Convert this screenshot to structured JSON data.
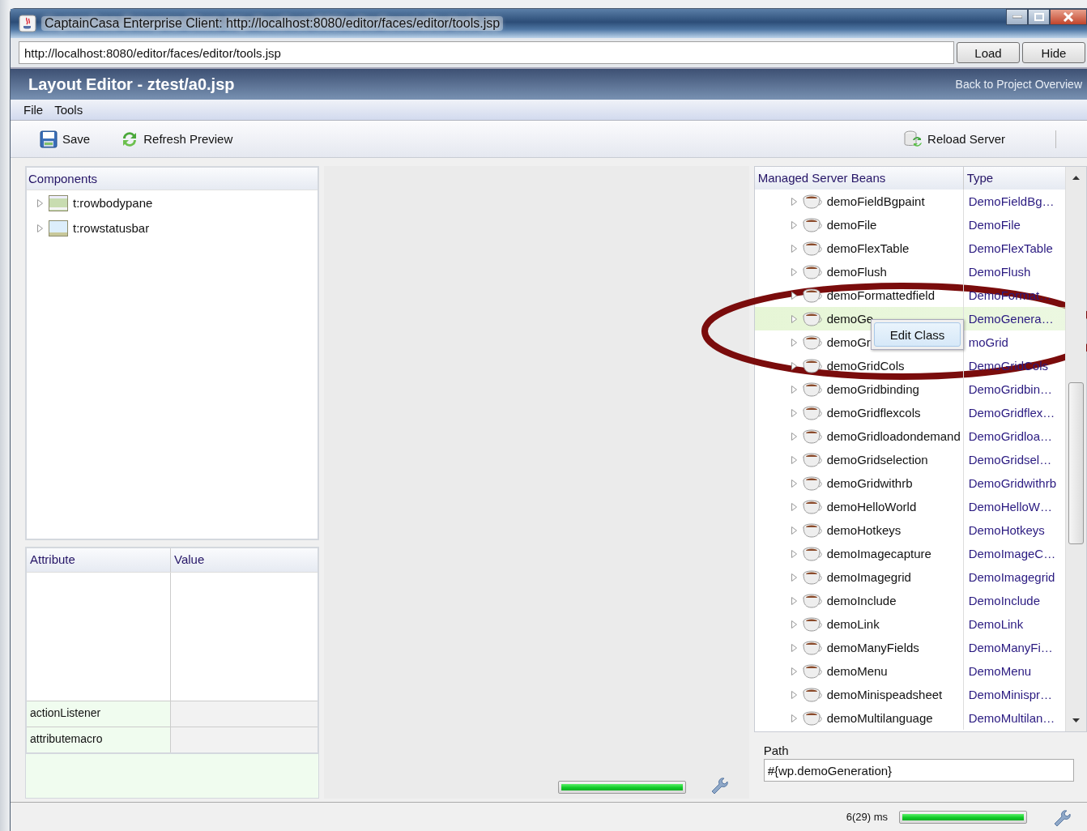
{
  "window": {
    "title": "CaptainCasa Enterprise Client: http://localhost:8080/editor/faces/editor/tools.jsp"
  },
  "address": {
    "value": "http://localhost:8080/editor/faces/editor/tools.jsp",
    "buttons": [
      "Load",
      "Hide"
    ]
  },
  "header": {
    "title": "Layout Editor - ztest/a0.jsp",
    "link": "Back to Project Overview"
  },
  "menu": [
    "File",
    "Tools"
  ],
  "toolbar": [
    {
      "label": "Save",
      "kind": "save"
    },
    {
      "label": "Refresh Preview",
      "kind": "refresh"
    },
    {
      "label": "Reload Server",
      "kind": "reload"
    }
  ],
  "components": {
    "title": "Components",
    "items": [
      {
        "label": "t:rowbodypane",
        "kind": "bodypane",
        "expanded": false
      },
      {
        "label": "t:rowstatusbar",
        "kind": "statusbar",
        "expanded": false
      }
    ]
  },
  "attributes": {
    "columns": [
      "Attribute",
      "Value"
    ],
    "rows": [
      {
        "attribute": "actionListener"
      },
      {
        "attribute": "attributemacro"
      }
    ]
  },
  "preview": {
    "level": 1
  },
  "beans": {
    "columns": [
      "Managed Server Beans",
      "Type"
    ],
    "rows": [
      {
        "name": "demoFieldBgpaint",
        "type": "DemoFieldBg…",
        "expanded": false,
        "selected": false
      },
      {
        "name": "demoFile",
        "type": "DemoFile",
        "expanded": false,
        "selected": false
      },
      {
        "name": "demoFlexTable",
        "type": "DemoFlexTable",
        "expanded": false,
        "selected": false
      },
      {
        "name": "demoFlush",
        "type": "DemoFlush",
        "expanded": false,
        "selected": false
      },
      {
        "name": "demoFormattedfield",
        "type": "DemoFormat…",
        "expanded": false,
        "selected": false
      },
      {
        "name": "demoGe",
        "type": "DemoGenera…",
        "expanded": false,
        "selected": true
      },
      {
        "name": "demoGr",
        "type": "moGrid",
        "expanded": false,
        "selected": false
      },
      {
        "name": "demoGridCols",
        "type": "DemoGridCols",
        "expanded": false,
        "selected": false
      },
      {
        "name": "demoGridbinding",
        "type": "DemoGridbin…",
        "expanded": false,
        "selected": false
      },
      {
        "name": "demoGridflexcols",
        "type": "DemoGridflex…",
        "expanded": false,
        "selected": false
      },
      {
        "name": "demoGridloadondemand",
        "type": "DemoGridloa…",
        "expanded": false,
        "selected": false
      },
      {
        "name": "demoGridselection",
        "type": "DemoGridsel…",
        "expanded": false,
        "selected": false
      },
      {
        "name": "demoGridwithrb",
        "type": "DemoGridwithrb",
        "expanded": false,
        "selected": false
      },
      {
        "name": "demoHelloWorld",
        "type": "DemoHelloW…",
        "expanded": false,
        "selected": false
      },
      {
        "name": "demoHotkeys",
        "type": "DemoHotkeys",
        "expanded": false,
        "selected": false
      },
      {
        "name": "demoImagecapture",
        "type": "DemoImageC…",
        "expanded": false,
        "selected": false
      },
      {
        "name": "demoImagegrid",
        "type": "DemoImagegrid",
        "expanded": false,
        "selected": false
      },
      {
        "name": "demoInclude",
        "type": "DemoInclude",
        "expanded": false,
        "selected": false
      },
      {
        "name": "demoLink",
        "type": "DemoLink",
        "expanded": false,
        "selected": false
      },
      {
        "name": "demoManyFields",
        "type": "DemoManyFi…",
        "expanded": false,
        "selected": false
      },
      {
        "name": "demoMenu",
        "type": "DemoMenu",
        "expanded": false,
        "selected": false
      },
      {
        "name": "demoMinispeadsheet",
        "type": "DemoMinispr…",
        "expanded": false,
        "selected": false
      },
      {
        "name": "demoMultilanguage",
        "type": "DemoMultilan…",
        "expanded": false,
        "selected": false
      }
    ],
    "context_menu": {
      "items": [
        "Edit Class"
      ]
    }
  },
  "path": {
    "label": "Path",
    "value": "#{wp.demoGeneration}"
  },
  "status_bar": {
    "timing": "6(29) ms",
    "level": 1
  }
}
